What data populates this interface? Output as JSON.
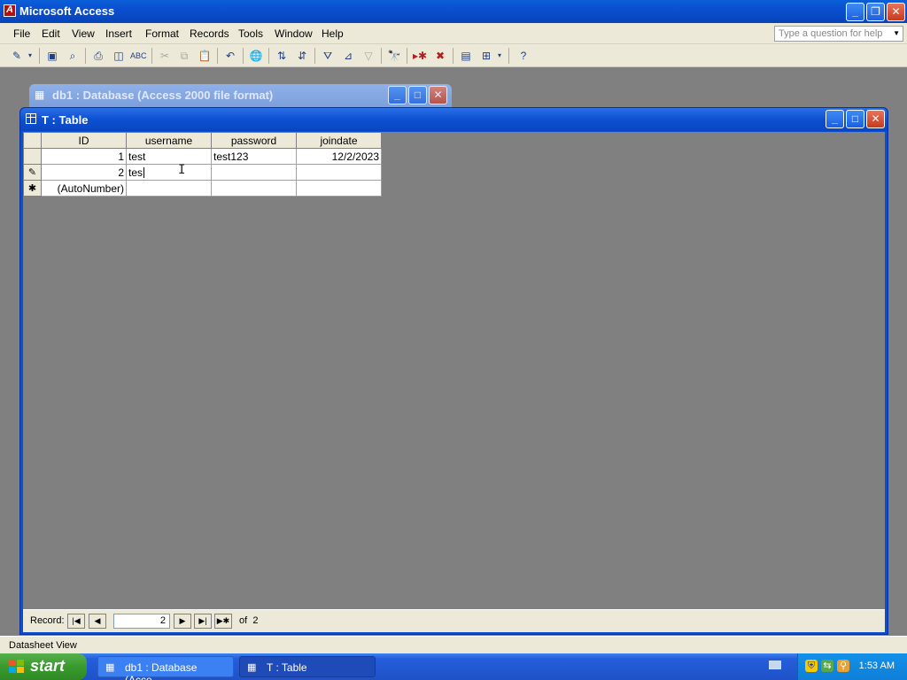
{
  "app": {
    "title": "Microsoft Access"
  },
  "menu": {
    "items": [
      "File",
      "Edit",
      "View",
      "Insert",
      "Format",
      "Records",
      "Tools",
      "Window",
      "Help"
    ],
    "help_placeholder": "Type a question for help"
  },
  "toolbar": {
    "icons": [
      "design-view-icon",
      "save-icon",
      "search-file-icon",
      "print-icon",
      "print-preview-icon",
      "spelling-icon",
      "cut-icon",
      "copy-icon",
      "paste-icon",
      "undo-icon",
      "insert-hyperlink-icon",
      "sort-ascending-icon",
      "sort-descending-icon",
      "filter-by-selection-icon",
      "filter-by-form-icon",
      "apply-filter-icon",
      "find-icon",
      "new-record-icon",
      "delete-record-icon",
      "database-window-icon",
      "new-object-icon",
      "help-icon"
    ]
  },
  "db_window": {
    "title": "db1 : Database (Access 2000 file format)"
  },
  "table_window": {
    "title": "T : Table"
  },
  "datasheet": {
    "columns": [
      "ID",
      "username",
      "password",
      "joindate"
    ],
    "rows": [
      {
        "selector": "",
        "id": "1",
        "username": "test",
        "password": "test123",
        "joindate": "12/2/2023"
      },
      {
        "selector": "✎",
        "id": "2",
        "username": "tes",
        "password": "",
        "joindate": ""
      },
      {
        "selector": "✱",
        "id": "(AutoNumber)",
        "username": "",
        "password": "",
        "joindate": ""
      }
    ]
  },
  "navigation": {
    "label": "Record:",
    "current": "2",
    "of_label": "of",
    "total": "2"
  },
  "status": {
    "text": "Datasheet View"
  },
  "taskbar": {
    "start_label": "start",
    "tasks": [
      "db1 : Database (Acce...",
      "T : Table"
    ],
    "clock": "1:53 AM"
  }
}
